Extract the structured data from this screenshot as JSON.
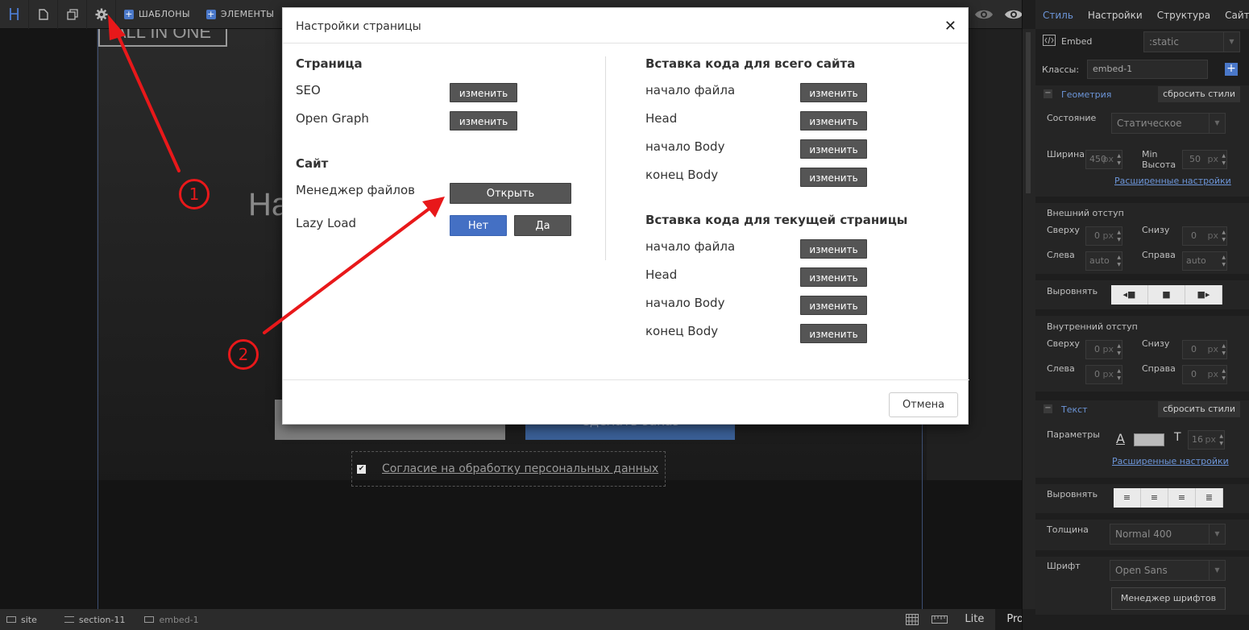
{
  "toolbar": {
    "logo": "H",
    "templates_label": "ШАБЛОНЫ",
    "elements_label": "ЭЛЕМЕНТЫ"
  },
  "canvas": {
    "hero_logo": "ALL IN ONE",
    "hero_heading": "На",
    "button_text": "Сделать заказ",
    "consent_text": "Согласие на обработку персональных данных"
  },
  "bottombar": {
    "crumbs": [
      "site",
      "section-11",
      "embed-1"
    ],
    "modes": [
      "Lite",
      "Pro"
    ],
    "active_mode": "Pro"
  },
  "panel": {
    "tabs": [
      "Стиль",
      "Настройки",
      "Структура",
      "Сайт"
    ],
    "active_tab": "Стиль",
    "element_label": "Embed",
    "state_select": ":static",
    "classes_label": "Классы:",
    "classes_value": "embed-1",
    "geometry": {
      "title": "Геометрия",
      "reset": "сбросить стили",
      "state_label": "Состояние",
      "state_value": "Статическое",
      "width_label": "Ширина",
      "width_value": "450",
      "minh_label": "Min Высота",
      "minh_value": "50",
      "unit": "px",
      "advanced": "Расширенные настройки",
      "margin_title": "Внешний отступ",
      "top": "Сверху",
      "bottom": "Снизу",
      "left": "Слева",
      "right": "Справа",
      "margin_top": "0",
      "margin_bottom": "0",
      "margin_left": "auto",
      "margin_right": "auto",
      "align_label": "Выровнять",
      "padding_title": "Внутренний отступ",
      "pad_top": "0",
      "pad_bottom": "0",
      "pad_left": "0",
      "pad_right": "0"
    },
    "text": {
      "title": "Текст",
      "reset": "сбросить стили",
      "params_label": "Параметры",
      "size_value": "16",
      "unit": "px",
      "advanced": "Расширенные настройки",
      "align_label": "Выровнять",
      "weight_label": "Толщина",
      "weight_value": "Normal 400",
      "font_label": "Шрифт",
      "font_value": "Open Sans",
      "font_manager": "Менеджер шрифтов"
    }
  },
  "modal": {
    "title": "Настройки страницы",
    "left": {
      "page_heading": "Страница",
      "seo_label": "SEO",
      "og_label": "Open Graph",
      "edit": "изменить",
      "site_heading": "Сайт",
      "files_label": "Менеджер файлов",
      "open": "Открыть",
      "lazy_label": "Lazy Load",
      "no": "Нет",
      "yes": "Да"
    },
    "right": {
      "site_heading": "Вставка кода для всего сайта",
      "page_heading": "Вставка кода для текущей страницы",
      "items": [
        "начало файла",
        "Head",
        "начало Body",
        "конец Body"
      ],
      "edit": "изменить"
    },
    "cancel": "Отмена"
  },
  "annotations": {
    "marker1": "1",
    "marker2": "2",
    "color": "#e8181a"
  }
}
